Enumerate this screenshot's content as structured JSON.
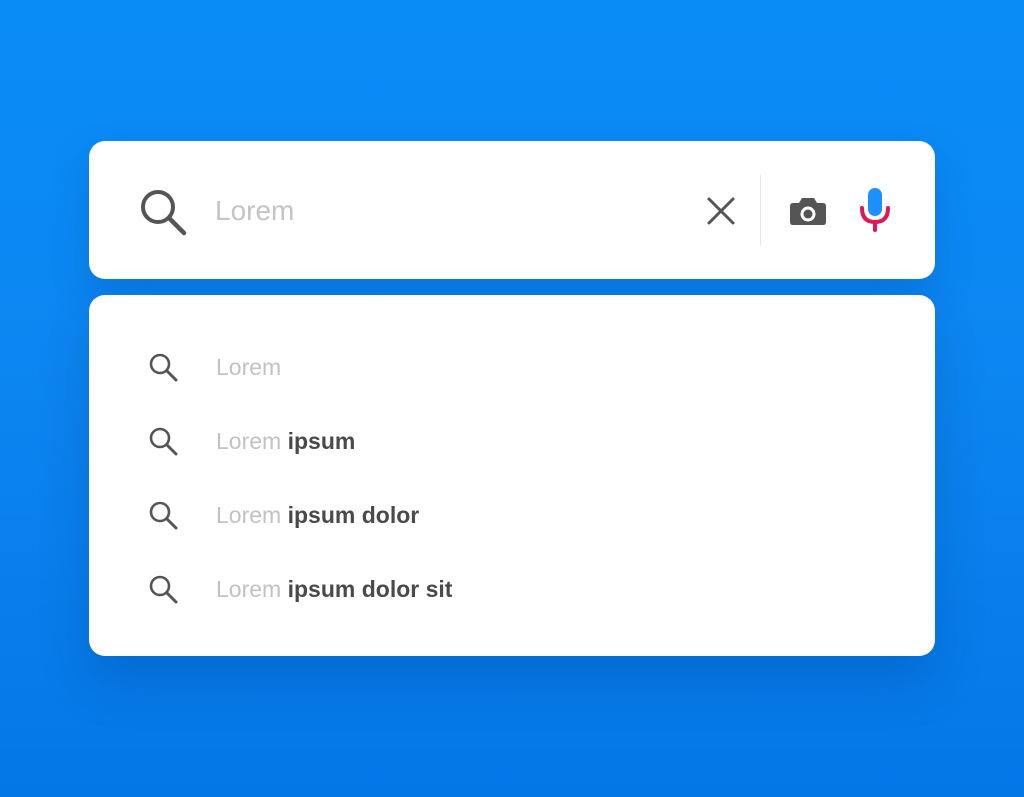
{
  "search": {
    "placeholder": "Lorem",
    "value": ""
  },
  "icons": {
    "search": "search-icon",
    "clear": "close-icon",
    "camera": "camera-icon",
    "microphone": "microphone-icon"
  },
  "colors": {
    "background_top": "#0a8cf7",
    "background_bottom": "#0477e7",
    "panel": "#ffffff",
    "icon": "#555555",
    "mic_accent": "#e0185a",
    "mic_body": "#1e8fff",
    "placeholder_text": "#c4c4c4",
    "suggestion_prefix": "#c2c2c2",
    "suggestion_completion": "#4a4a4a"
  },
  "suggestions": [
    {
      "prefix": "Lorem",
      "completion": ""
    },
    {
      "prefix": "Lorem ",
      "completion": "ipsum"
    },
    {
      "prefix": "Lorem ",
      "completion": "ipsum dolor"
    },
    {
      "prefix": "Lorem ",
      "completion": "ipsum dolor sit"
    }
  ]
}
